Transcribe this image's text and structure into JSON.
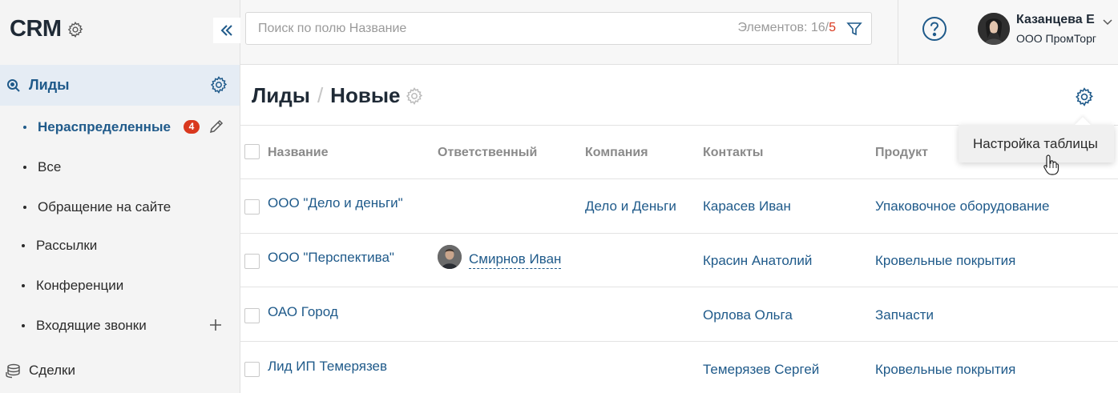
{
  "sidebar": {
    "logo": "CRM",
    "active_section": "Лиды",
    "items": [
      {
        "label": "Нераспределенные",
        "badge": "4",
        "active": true
      },
      {
        "label": "Все"
      },
      {
        "label": "Обращение на сайте"
      },
      {
        "label": "Рассылки"
      },
      {
        "label": "Конференции"
      },
      {
        "label": "Входящие звонки"
      }
    ],
    "bottom_section": "Сделки"
  },
  "topbar": {
    "search_placeholder": "Поиск по полю Название",
    "count_label": "Элементов: 16",
    "count_sep": "/",
    "count_filtered": "5",
    "user_name": "Казанцева Е",
    "user_org": "ООО ПромТорг"
  },
  "page": {
    "crumb_1": "Лиды",
    "crumb_sep": "/",
    "crumb_2": "Новые"
  },
  "table": {
    "headers": [
      "Название",
      "Ответственный",
      "Компания",
      "Контакты",
      "Продукт"
    ],
    "rows": [
      {
        "name": "ООО \"Дело и деньги\"",
        "responsible": "",
        "company": "Дело и Деньги",
        "contact": "Карасев Иван",
        "product": "Упаковочное оборудование"
      },
      {
        "name": "ООО \"Перспектива\"",
        "responsible": "Смирнов Иван",
        "company": "",
        "contact": "Красин Анатолий",
        "product": "Кровельные покрытия"
      },
      {
        "name": "ОАО Город",
        "responsible": "",
        "company": "",
        "contact": "Орлова Ольга",
        "product": "Запчасти"
      },
      {
        "name": "Лид ИП Темерязев",
        "responsible": "",
        "company": "",
        "contact": "Темерязев Сергей",
        "product": "Кровельные покрытия"
      }
    ]
  },
  "popup": {
    "item": "Настройка таблицы"
  },
  "icons": {
    "accent": "#1f5a8a",
    "badge": "#d9381e"
  }
}
